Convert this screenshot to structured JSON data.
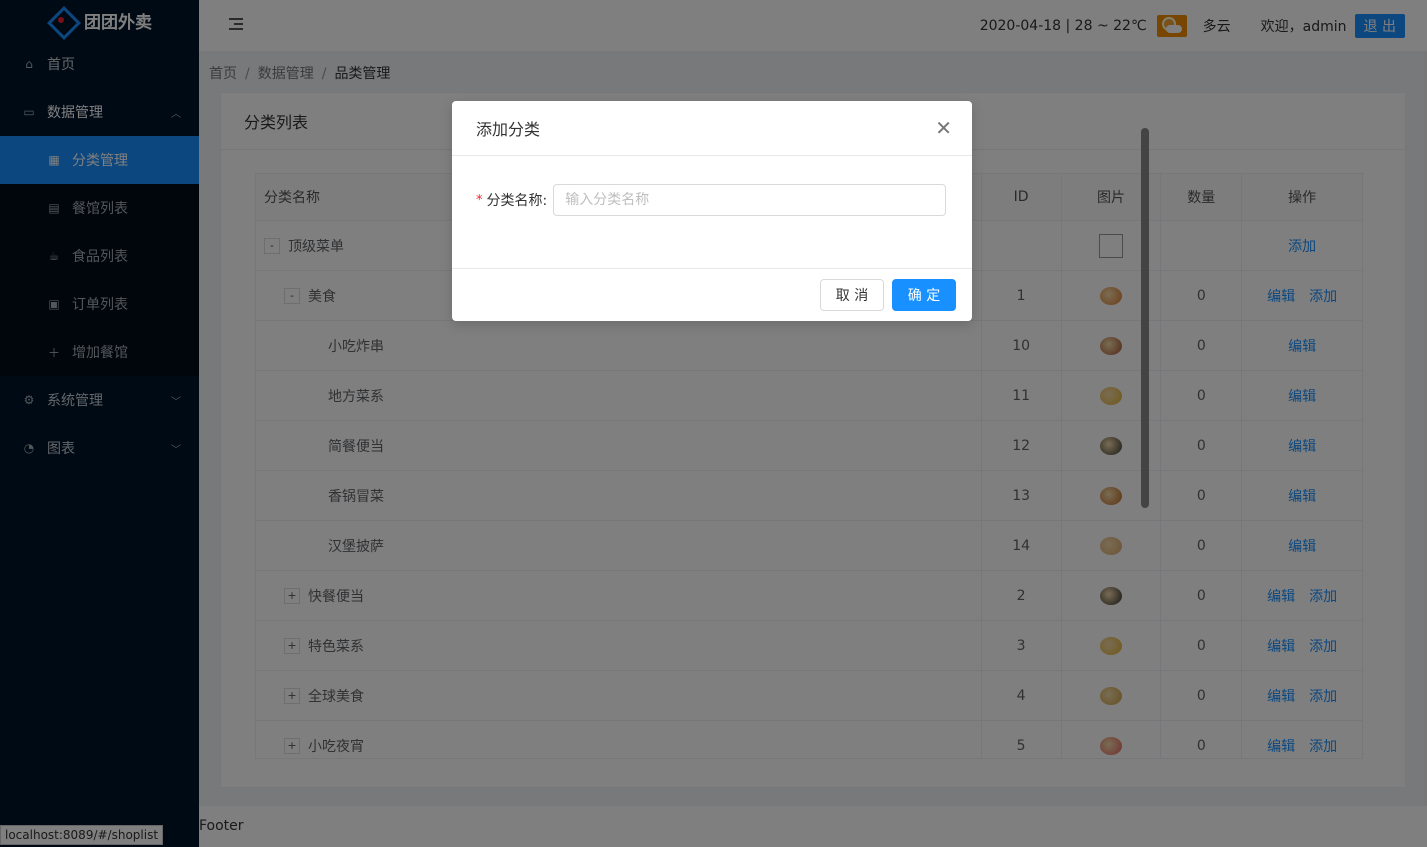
{
  "app": {
    "name": "团团外卖"
  },
  "sidebar": {
    "home": "首页",
    "data_mgmt": "数据管理",
    "sub_items": [
      "分类管理",
      "餐馆列表",
      "食品列表",
      "订单列表",
      "增加餐馆"
    ],
    "system": "系统管理",
    "charts": "图表"
  },
  "header": {
    "date_weather": "2020-04-18 | 28 ~ 22℃",
    "weather_text": "多云",
    "welcome": "欢迎，admin",
    "logout": "退 出"
  },
  "breadcrumb": [
    "首页",
    "数据管理",
    "品类管理"
  ],
  "card": {
    "title": "分类列表"
  },
  "table": {
    "headers": {
      "name": "分类名称",
      "id": "ID",
      "image": "图片",
      "count": "数量",
      "ops": "操作"
    },
    "rows": [
      {
        "name": "顶级菜单",
        "toggle": "-",
        "level": 0,
        "id": "",
        "count": "",
        "ops": [
          "添加"
        ],
        "thumb_color": ""
      },
      {
        "name": "美食",
        "toggle": "-",
        "level": 1,
        "id": "1",
        "count": "0",
        "ops": [
          "编辑",
          "添加"
        ],
        "thumb_color": "#d9782a"
      },
      {
        "name": "小吃炸串",
        "toggle": "",
        "level": 2,
        "id": "10",
        "count": "0",
        "ops": [
          "编辑"
        ],
        "thumb_color": "#a0522d"
      },
      {
        "name": "地方菜系",
        "toggle": "",
        "level": 2,
        "id": "11",
        "count": "0",
        "ops": [
          "编辑"
        ],
        "thumb_color": "#e0b030"
      },
      {
        "name": "简餐便当",
        "toggle": "",
        "level": 2,
        "id": "12",
        "count": "0",
        "ops": [
          "编辑"
        ],
        "thumb_color": "#333333"
      },
      {
        "name": "香锅冒菜",
        "toggle": "",
        "level": 2,
        "id": "13",
        "count": "0",
        "ops": [
          "编辑"
        ],
        "thumb_color": "#b8651f"
      },
      {
        "name": "汉堡披萨",
        "toggle": "",
        "level": 2,
        "id": "14",
        "count": "0",
        "ops": [
          "编辑"
        ],
        "thumb_color": "#d9a46a"
      },
      {
        "name": "快餐便当",
        "toggle": "+",
        "level": 1,
        "id": "2",
        "count": "0",
        "ops": [
          "编辑",
          "添加"
        ],
        "thumb_color": "#2a2a2a"
      },
      {
        "name": "特色菜系",
        "toggle": "+",
        "level": 1,
        "id": "3",
        "count": "0",
        "ops": [
          "编辑",
          "添加"
        ],
        "thumb_color": "#e0b030"
      },
      {
        "name": "全球美食",
        "toggle": "+",
        "level": 1,
        "id": "4",
        "count": "0",
        "ops": [
          "编辑",
          "添加"
        ],
        "thumb_color": "#c9a040"
      },
      {
        "name": "小吃夜宵",
        "toggle": "+",
        "level": 1,
        "id": "5",
        "count": "0",
        "ops": [
          "编辑",
          "添加"
        ],
        "thumb_color": "#e06060"
      }
    ]
  },
  "footer": {
    "text": "Footer"
  },
  "status_url": "localhost:8089/#/shoplist",
  "modal": {
    "title": "添加分类",
    "label": "分类名称:",
    "placeholder": "输入分类名称",
    "value": "",
    "cancel": "取 消",
    "ok": "确 定"
  }
}
